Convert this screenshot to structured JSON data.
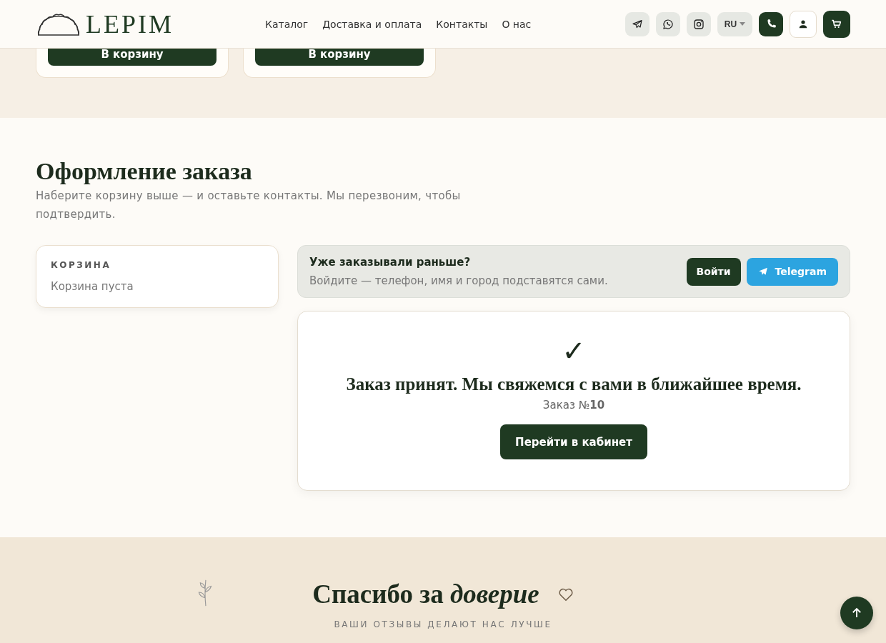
{
  "header": {
    "logo": "LEPIM",
    "nav": [
      "Каталог",
      "Доставка и оплата",
      "Контакты",
      "О нас"
    ],
    "language": "RU"
  },
  "products": [
    {
      "button": "В корзину"
    },
    {
      "button": "В корзину"
    }
  ],
  "checkout": {
    "title": "Оформление заказа",
    "subtitle": "Наберите корзину выше — и оставьте контакты. Мы перезвоним, чтобы подтвердить.",
    "cart": {
      "title": "КОРЗИНА",
      "empty": "Корзина пуста"
    },
    "login": {
      "title": "Уже заказывали раньше?",
      "text": "Войдите — телефон, имя и город подставятся сами.",
      "buttons": [
        {
          "kind": "login",
          "label": "Войти"
        },
        {
          "kind": "telegram",
          "label": "Telegram"
        }
      ]
    },
    "success": {
      "mark": "✓",
      "message": "Заказ принят. Мы свяжемся с вами в ближайшее время.",
      "order": "Заказ №**10**",
      "button": "Перейти в кабинет"
    }
  },
  "reviews": {
    "title": "Спасибо за *доверие*",
    "subtitle": "ВАШИ ОТЗЫВЫ ДЕЛАЮТ НАС ЛУЧШЕ"
  }
}
